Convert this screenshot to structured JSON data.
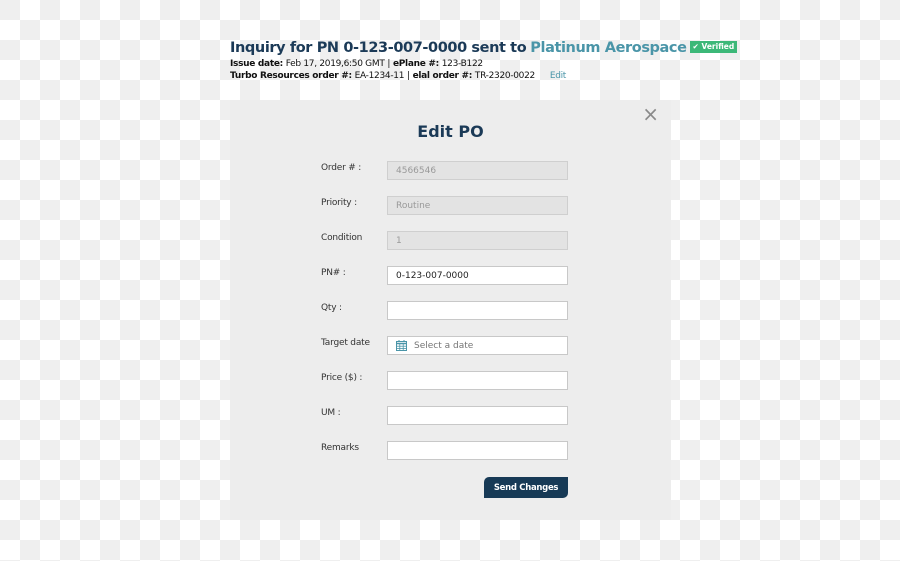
{
  "header": {
    "title_prefix": "Inquiry for PN 0-123-007-0000 sent to",
    "vendor": "Platinum Aerospace",
    "verified_badge": "✔ Verified",
    "issue_date_label": "Issue date:",
    "issue_date_value": "Feb 17, 2019,6:50 GMT",
    "eplane_label": "ePlane #:",
    "eplane_value": "123-B122",
    "separator": "|",
    "turbo_label": "Turbo Resources order #:",
    "turbo_value": "EA-1234-11",
    "elal_label": "elal order #:",
    "elal_value": "TR-2320-0022",
    "edit_link": "Edit"
  },
  "modal": {
    "title": "Edit PO",
    "close_icon": "×",
    "fields": [
      {
        "label": "Order # :",
        "value": "4566546",
        "placeholder": "",
        "disabled": true
      },
      {
        "label": "Priority :",
        "value": "Routine",
        "placeholder": "",
        "disabled": true
      },
      {
        "label": "Condition",
        "value": "1",
        "placeholder": "",
        "disabled": true
      },
      {
        "label": "PN# :",
        "value": "0-123-007-0000",
        "placeholder": "",
        "disabled": false
      },
      {
        "label": "Qty :",
        "value": "",
        "placeholder": "",
        "disabled": false
      },
      {
        "label": "Target date",
        "value": "",
        "placeholder": "Select a date",
        "disabled": false,
        "icon": "calendar-icon"
      },
      {
        "label": "Price ($) :",
        "value": "",
        "placeholder": "",
        "disabled": false
      },
      {
        "label": "UM :",
        "value": "",
        "placeholder": "",
        "disabled": false
      },
      {
        "label": "Remarks",
        "value": "",
        "placeholder": "",
        "disabled": false
      }
    ],
    "submit_label": "Send Changes"
  },
  "colors": {
    "primary": "#173a56",
    "accent": "#4a95a8",
    "verified": "#3cb878"
  }
}
